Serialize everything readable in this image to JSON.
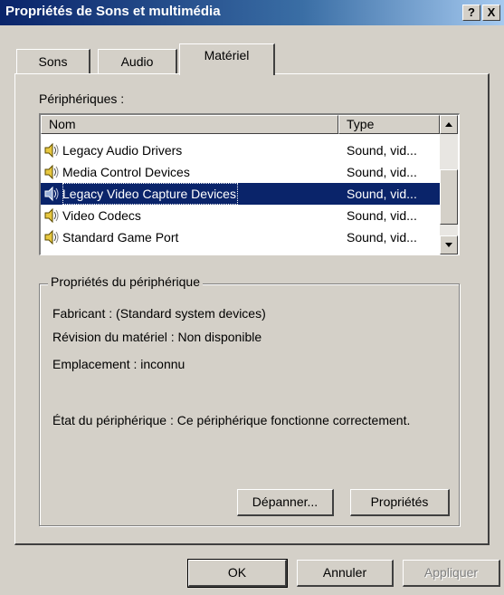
{
  "window": {
    "title": "Propriétés de Sons et multimédia",
    "help_label": "?",
    "close_label": "X"
  },
  "tabs": [
    {
      "label": "Sons",
      "active": false
    },
    {
      "label": "Audio",
      "active": false
    },
    {
      "label": "Matériel",
      "active": true
    }
  ],
  "devices": {
    "label": "Périphériques :",
    "columns": {
      "name": "Nom",
      "type": "Type"
    },
    "rows": [
      {
        "name": "Legacy Audio Drivers",
        "type": "Sound, vid...",
        "selected": false,
        "icon": "speaker-icon"
      },
      {
        "name": "Media Control Devices",
        "type": "Sound, vid...",
        "selected": false,
        "icon": "speaker-icon"
      },
      {
        "name": "Legacy Video Capture Devices",
        "type": "Sound, vid...",
        "selected": true,
        "icon": "speaker-icon"
      },
      {
        "name": "Video Codecs",
        "type": "Sound, vid...",
        "selected": false,
        "icon": "speaker-icon"
      },
      {
        "name": "Standard Game Port",
        "type": "Sound, vid...",
        "selected": false,
        "icon": "speaker-icon"
      }
    ]
  },
  "properties": {
    "label": "Propriétés du périphérique",
    "manufacturer": "Fabricant : (Standard system devices)",
    "revision": "Révision du matériel : Non disponible",
    "location": "Emplacement : inconnu",
    "status": "État du périphérique : Ce périphérique fonctionne correctement.",
    "troubleshoot_label": "Dépanner...",
    "properties_label": "Propriétés"
  },
  "footer": {
    "ok_label": "OK",
    "cancel_label": "Annuler",
    "apply_label": "Appliquer"
  }
}
